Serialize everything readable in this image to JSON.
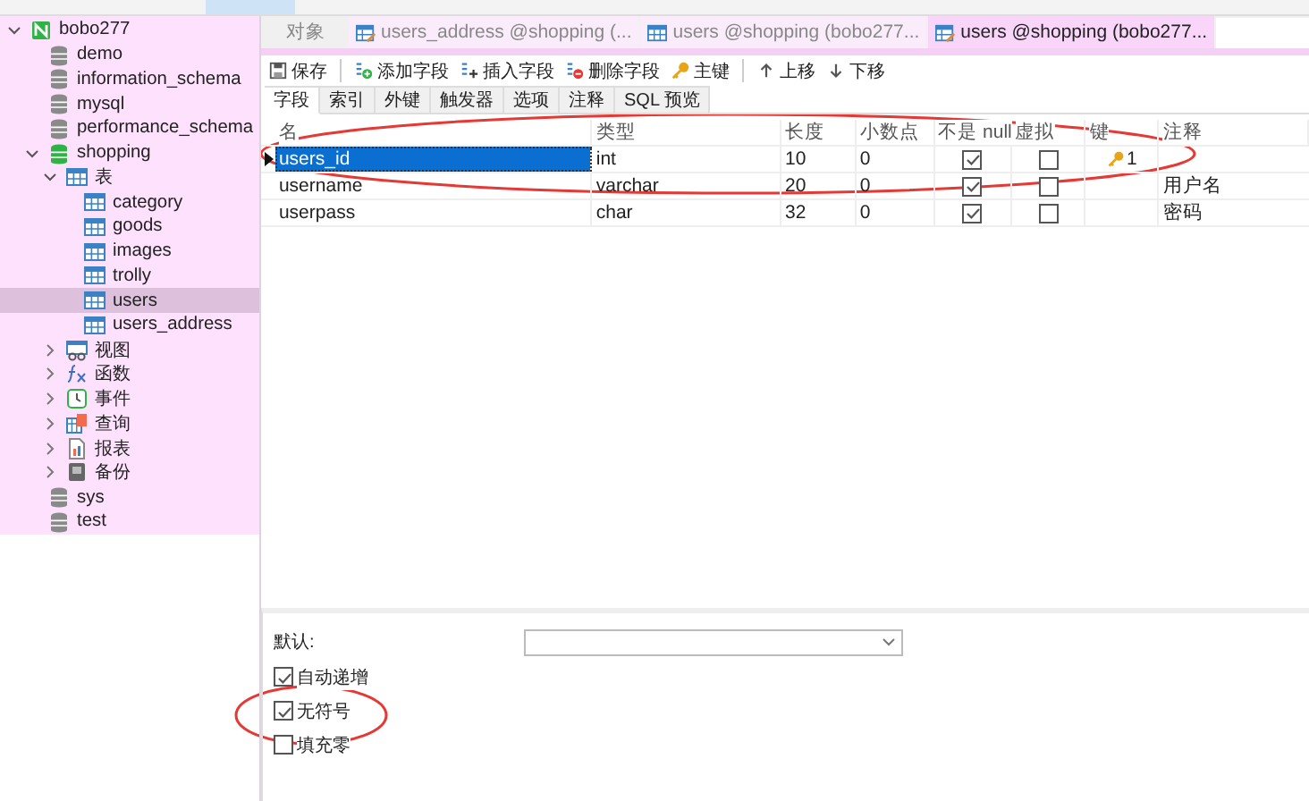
{
  "sidebar": {
    "tree": [
      {
        "label": "bobo277",
        "kind": "connection",
        "expanded": true,
        "selected": false,
        "children": [
          {
            "label": "demo",
            "kind": "database",
            "selected": false
          },
          {
            "label": "information_schema",
            "kind": "database",
            "selected": false
          },
          {
            "label": "mysql",
            "kind": "database",
            "selected": false
          },
          {
            "label": "performance_schema",
            "kind": "database",
            "selected": false
          },
          {
            "label": "shopping",
            "kind": "database-open",
            "expanded": true,
            "selected": false,
            "children": [
              {
                "label": "表",
                "kind": "tables",
                "expanded": true,
                "selected": false,
                "children": [
                  {
                    "label": "category",
                    "kind": "table",
                    "selected": false
                  },
                  {
                    "label": "goods",
                    "kind": "table",
                    "selected": false
                  },
                  {
                    "label": "images",
                    "kind": "table",
                    "selected": false
                  },
                  {
                    "label": "trolly",
                    "kind": "table",
                    "selected": false
                  },
                  {
                    "label": "users",
                    "kind": "table",
                    "selected": true
                  },
                  {
                    "label": "users_address",
                    "kind": "table",
                    "selected": false
                  }
                ]
              },
              {
                "label": "视图",
                "kind": "views",
                "expanded": false,
                "selected": false
              },
              {
                "label": "函数",
                "kind": "functions",
                "expanded": false,
                "selected": false
              },
              {
                "label": "事件",
                "kind": "events",
                "expanded": false,
                "selected": false
              },
              {
                "label": "查询",
                "kind": "queries",
                "expanded": false,
                "selected": false
              },
              {
                "label": "报表",
                "kind": "reports",
                "expanded": false,
                "selected": false
              },
              {
                "label": "备份",
                "kind": "backups",
                "expanded": false,
                "selected": false
              }
            ]
          },
          {
            "label": "sys",
            "kind": "database",
            "selected": false
          },
          {
            "label": "test",
            "kind": "database",
            "selected": false
          }
        ]
      }
    ]
  },
  "tabs": [
    {
      "label": "对象",
      "kind": "objects",
      "selected": false
    },
    {
      "label": "users_address @shopping (...",
      "kind": "design",
      "selected": false
    },
    {
      "label": "users @shopping (bobo277...",
      "kind": "grid",
      "selected": false
    },
    {
      "label": "users @shopping (bobo277...",
      "kind": "design",
      "selected": true
    }
  ],
  "toolbar": [
    {
      "label": "保存",
      "kind": "save"
    },
    {
      "label": "添加字段",
      "kind": "add"
    },
    {
      "label": "插入字段",
      "kind": "insert"
    },
    {
      "label": "删除字段",
      "kind": "delete"
    },
    {
      "label": "主键",
      "kind": "key"
    },
    {
      "label": "上移",
      "kind": "up"
    },
    {
      "label": "下移",
      "kind": "down"
    }
  ],
  "field_tabs": [
    {
      "label": "字段",
      "selected": true
    },
    {
      "label": "索引",
      "selected": false
    },
    {
      "label": "外键",
      "selected": false
    },
    {
      "label": "触发器",
      "selected": false
    },
    {
      "label": "选项",
      "selected": false
    },
    {
      "label": "注释",
      "selected": false
    },
    {
      "label": "SQL 预览",
      "selected": false
    }
  ],
  "fields_table": {
    "columns": [
      "名",
      "类型",
      "长度",
      "小数点",
      "不是 null",
      "虚拟",
      "键",
      "注释"
    ],
    "rows": [
      {
        "current": true,
        "selected": true,
        "name": "users_id",
        "type": "int",
        "length": "10",
        "decimals": "0",
        "not_null": true,
        "virtual": false,
        "key": "1"
      },
      {
        "current": false,
        "selected": false,
        "name": "username",
        "type": "varchar",
        "length": "20",
        "decimals": "0",
        "not_null": true,
        "virtual": false,
        "comment": "用户名"
      },
      {
        "current": false,
        "selected": false,
        "name": "userpass",
        "type": "char",
        "length": "32",
        "decimals": "0",
        "not_null": true,
        "virtual": false,
        "comment": "密码"
      }
    ]
  },
  "options": {
    "default_label": "默认:",
    "checkboxes": [
      {
        "label": "自动递增",
        "checked": true
      },
      {
        "label": "无符号",
        "checked": true
      },
      {
        "label": "填充零",
        "checked": false
      }
    ]
  }
}
